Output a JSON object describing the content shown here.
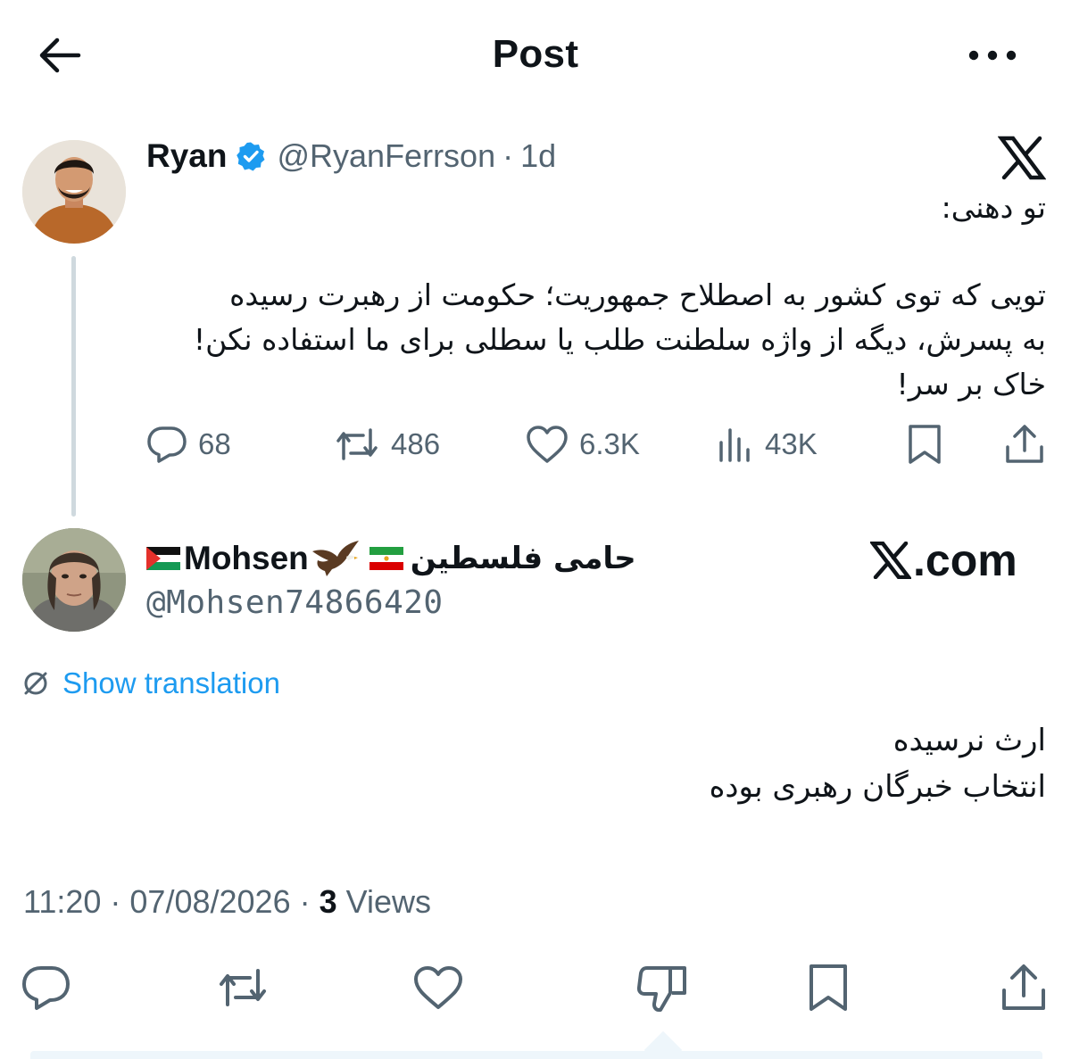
{
  "header": {
    "title": "Post",
    "back_icon": "arrow-left-icon",
    "more_icon": "ellipsis-icon"
  },
  "parent_post": {
    "author_name": "Ryan",
    "verified": true,
    "handle": "@RyanFerrson",
    "separator": "·",
    "time": "1d",
    "lines": [
      "تو دهنی:",
      "",
      "تویی که توی کشور به اصطلاح جمهوریت؛ حکومت از رهبرت رسیده",
      "به پسرش، دیگه از واژه سلطنت طلب یا سطلی برای ما استفاده نکن!",
      "خاک بر سر!"
    ],
    "stats": {
      "replies": "68",
      "reposts": "486",
      "likes": "6.3K",
      "views": "43K"
    }
  },
  "reply_post": {
    "name_latin": "Mohsen",
    "name_persian": "حامی فلسطین",
    "handle": "@Mohsen74866420",
    "watermark": ".com",
    "translate_label": "Show translation",
    "lines": [
      "ارث نرسیده",
      "انتخاب خبرگان رهبری بوده"
    ],
    "timestamp": "11:20 · 07/08/2026 · ",
    "views_count": "3",
    "views_label": " Views"
  },
  "colors": {
    "text": "#0f1419",
    "secondary": "#536471",
    "accent": "#1d9bf0",
    "divider": "#cfd9de"
  }
}
